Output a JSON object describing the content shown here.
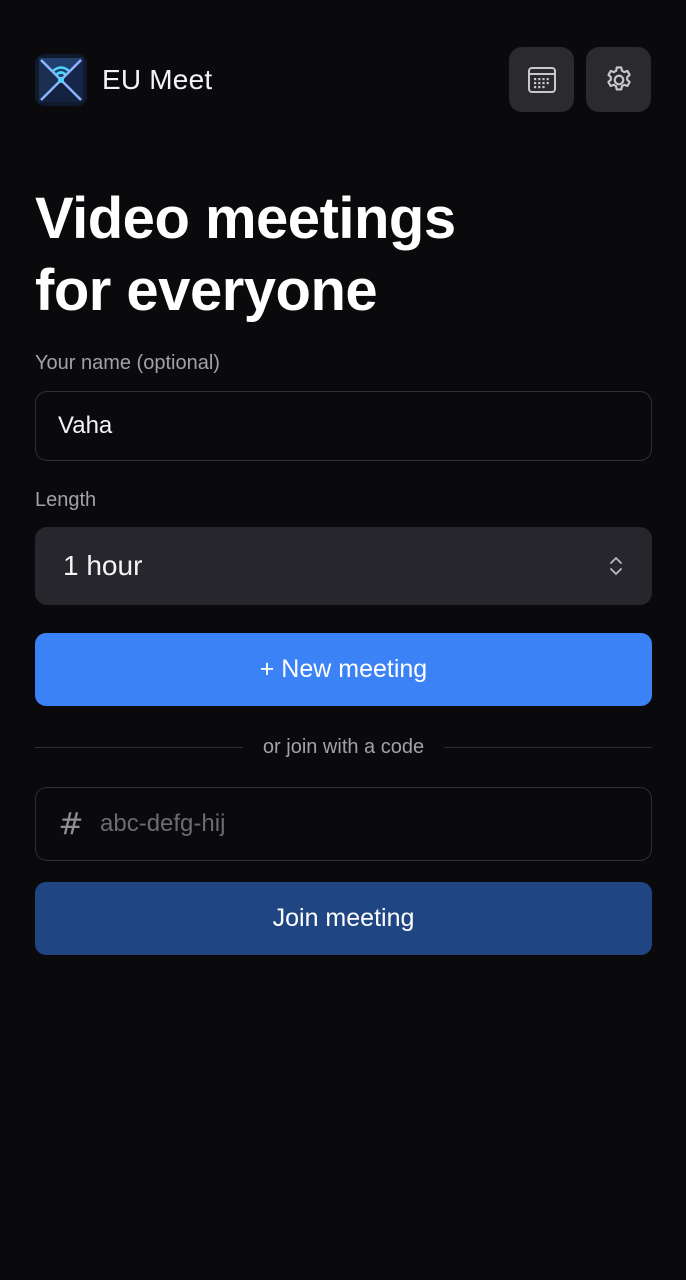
{
  "header": {
    "app_name": "EU Meet",
    "logo_icon": "eu-meet-logo-icon",
    "calendar_icon": "calendar-icon",
    "settings_icon": "gear-icon"
  },
  "hero": {
    "title_line1": "Video meetings",
    "title_line2": "for everyone"
  },
  "form": {
    "name_label": "Your name (optional)",
    "name_value": "Vaha",
    "length_label": "Length",
    "length_value": "1 hour",
    "new_meeting_label": "+ New meeting",
    "divider_text": "or join with a code",
    "code_prefix": "#",
    "code_placeholder": "abc-defg-hij",
    "code_value": "",
    "join_label": "Join meeting"
  },
  "colors": {
    "background": "#0a0a0c",
    "primary": "#3b82f6",
    "primary_muted": "#1f4582",
    "surface": "#26262c"
  }
}
